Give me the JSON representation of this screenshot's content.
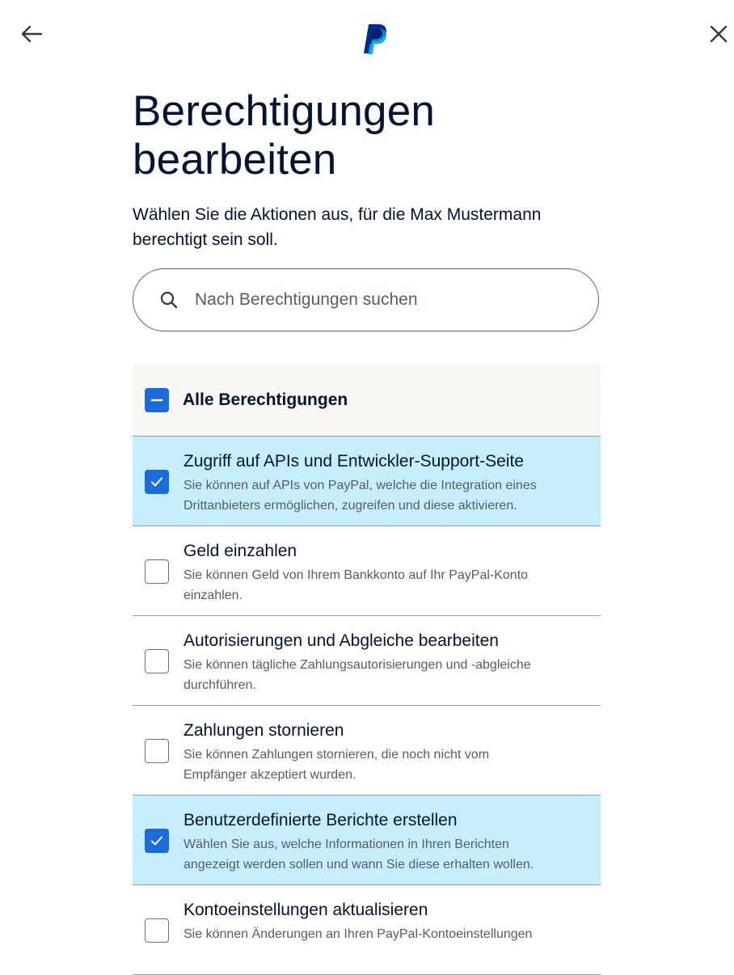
{
  "header": {
    "back_icon": "arrow-left-icon",
    "logo": "paypal-logo",
    "close_icon": "close-icon"
  },
  "page": {
    "title_line1": "Berechtigungen",
    "title_line2": "bearbeiten",
    "subtitle_line1": "Wählen Sie die Aktionen aus, für die Max Mustermann",
    "subtitle_line2": "berechtigt sein soll."
  },
  "search": {
    "placeholder": "Nach Berechtigungen suchen",
    "icon": "search-icon",
    "value": ""
  },
  "all_permissions": {
    "label": "Alle Berechtigungen",
    "state": "indeterminate"
  },
  "permissions": [
    {
      "title": "Zugriff auf APIs und Entwickler-Support-Seite",
      "desc_line1": "Sie können auf APIs von PayPal, welche die Integration eines",
      "desc_line2": "Drittanbieters ermöglichen, zugreifen und diese aktivieren.",
      "checked": true
    },
    {
      "title": "Geld einzahlen",
      "desc_line1": "Sie können Geld von Ihrem Bankkonto auf Ihr PayPal-Konto",
      "desc_line2": "einzahlen.",
      "checked": false
    },
    {
      "title": "Autorisierungen und Abgleiche bearbeiten",
      "desc_line1": "Sie können tägliche Zahlungsautorisierungen und -abgleiche",
      "desc_line2": "durchführen.",
      "checked": false
    },
    {
      "title": "Zahlungen stornieren",
      "desc_line1": "Sie können Zahlungen stornieren, die noch nicht vom",
      "desc_line2": "Empfänger akzeptiert wurden.",
      "checked": false
    },
    {
      "title": "Benutzerdefinierte Berichte erstellen",
      "desc_line1": "Wählen Sie aus, welche Informationen in Ihren Berichten",
      "desc_line2": "angezeigt werden sollen und wann Sie diese erhalten wollen.",
      "checked": true
    },
    {
      "title": "Kontoeinstellungen aktualisieren",
      "desc_line1": "Sie können Änderungen an Ihren PayPal-Kontoeinstellungen",
      "desc_line2": "",
      "checked": false
    }
  ],
  "colors": {
    "text_primary": "#001435",
    "text_secondary": "#545d68",
    "checkbox_blue": "#1b6bdc",
    "selected_row": "#c6eefc",
    "all_row_bg": "#f8f7f4",
    "divider": "#9aa0a6"
  }
}
